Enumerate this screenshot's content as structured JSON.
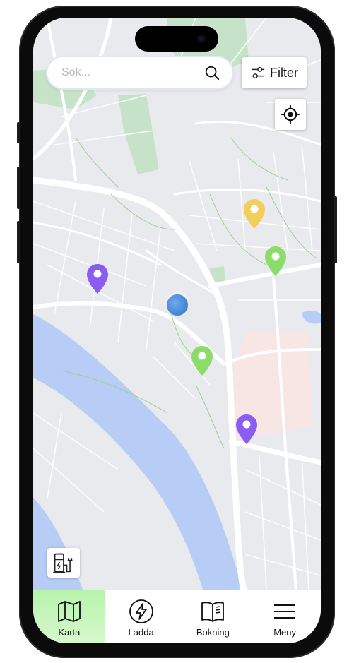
{
  "search": {
    "placeholder": "Sök..."
  },
  "filter_button": {
    "label": "Filter"
  },
  "pins": [
    {
      "color": "#f2cf5b",
      "name": "charger-pin-yellow"
    },
    {
      "color": "#8bdc6a",
      "name": "charger-pin-green"
    },
    {
      "color": "#8a5cf0",
      "name": "charger-pin-purple"
    },
    {
      "color": "#8bdc6a",
      "name": "charger-pin-green"
    },
    {
      "color": "#8a5cf0",
      "name": "charger-pin-purple"
    }
  ],
  "tabbar": {
    "tabs": [
      {
        "label": "Karta",
        "icon": "map-icon",
        "active": true
      },
      {
        "label": "Ladda",
        "icon": "lightning-icon",
        "active": false
      },
      {
        "label": "Bokning",
        "icon": "book-icon",
        "active": false
      },
      {
        "label": "Meny",
        "icon": "menu-icon",
        "active": false
      }
    ]
  },
  "colors": {
    "water": "#b7cdf5",
    "park": "#c6e3c9",
    "map_bg": "#e9eaee",
    "road": "#ffffff",
    "active_tab": "#c4f5b8"
  }
}
